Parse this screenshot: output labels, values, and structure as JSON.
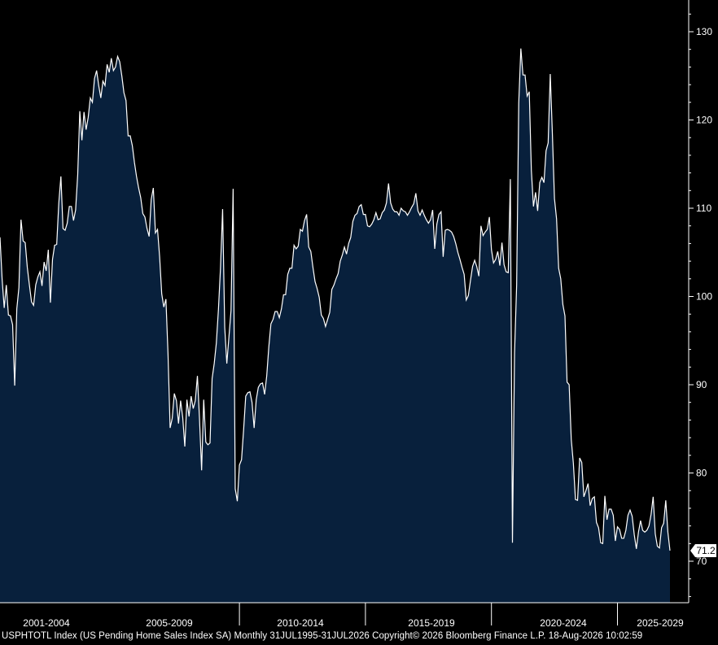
{
  "chart_data": {
    "type": "area",
    "ylim": [
      65,
      135
    ],
    "grid": false,
    "colors": {
      "background": "#000000",
      "fill": "#08203c",
      "line": "#ffffff",
      "axis": "#ffffff",
      "last_label_bg": "#ffffff",
      "last_label_text": "#000000"
    },
    "y_ticks": [
      70,
      80,
      90,
      100,
      110,
      120,
      130
    ],
    "x_period_labels": [
      "2001-2004",
      "2005-2009",
      "2010-2014",
      "2015-2019",
      "2020-2024",
      "2025-2029"
    ],
    "last_value_label": "71.2",
    "series": [
      {
        "values": [
          106.7,
          102,
          98.7,
          101.3,
          97.9,
          97.8,
          96.8,
          89.9,
          98.6,
          101,
          108.7,
          106.3,
          106.1,
          103.3,
          101.3,
          99.4,
          99,
          101.3,
          102.2,
          102.8,
          101.2,
          103.9,
          102.9,
          105.3,
          99.3,
          104.2,
          105.8,
          105.9,
          110.6,
          113.6,
          107.7,
          107.5,
          108.3,
          110.2,
          110.2,
          108.6,
          109.8,
          113.8,
          121,
          117.7,
          120.9,
          118.9,
          120.3,
          122.5,
          122,
          124.7,
          125.6,
          123.9,
          122.5,
          124.4,
          123.9,
          126.3,
          125.4,
          127,
          125.6,
          126,
          127.2,
          126.6,
          125,
          123.1,
          122.2,
          118.2,
          118.2,
          117.1,
          115.2,
          113.6,
          112.3,
          111.2,
          109.4,
          109,
          107.7,
          106.8,
          111,
          112.3,
          107.2,
          107.6,
          104.5,
          100.3,
          98.8,
          99.7,
          93.5,
          85.1,
          86.2,
          89,
          88.2,
          85.6,
          88.2,
          86.3,
          83,
          88.3,
          86.4,
          88.7,
          87.3,
          88.2,
          91,
          86.1,
          80.3,
          88.3,
          83.5,
          83.2,
          83.4,
          90.7,
          92.4,
          94.7,
          98.5,
          103.3,
          109.9,
          96.5,
          92.4,
          95.4,
          98.4,
          112.2,
          78.2,
          76.8,
          80.9,
          81.5,
          84.9,
          88.7,
          89.1,
          89.2,
          88,
          85.1,
          88.3,
          89.7,
          90.1,
          90.2,
          88.9,
          91,
          94.3,
          96.9,
          97.4,
          98.3,
          98.3,
          97.6,
          98.6,
          100.2,
          100.2,
          102.5,
          103.2,
          103.2,
          105.8,
          105.4,
          105.7,
          107.6,
          107.4,
          108.6,
          109.3,
          105.6,
          105.1,
          103.3,
          101.7,
          100.9,
          99.9,
          97.9,
          97.5,
          96.6,
          97.4,
          98.2,
          100.8,
          101.3,
          102,
          102.6,
          104,
          104.7,
          105.6,
          104.8,
          106,
          106.7,
          108.5,
          109.2,
          109.4,
          110.2,
          110.4,
          109.3,
          109.3,
          108,
          107.9,
          108.2,
          108.7,
          109.5,
          108.7,
          108.8,
          109.5,
          109.8,
          110.6,
          112.8,
          110.6,
          109.9,
          109.6,
          109.6,
          109.2,
          110,
          109.7,
          109.6,
          109.2,
          109.6,
          110.1,
          110.5,
          111.7,
          109.7,
          109.2,
          109.8,
          109.2,
          108.7,
          108.3,
          108.7,
          109.8,
          105.4,
          108.2,
          109.3,
          109.6,
          104.5,
          107.5,
          107.6,
          107.5,
          107.3,
          106.8,
          106,
          105,
          104.2,
          103.3,
          102.5,
          99.6,
          100.1,
          101.8,
          103.4,
          104.1,
          103.4,
          102.3,
          108,
          106.9,
          107.3,
          107.6,
          109,
          105.3,
          103.8,
          104.2,
          105.1,
          103.5,
          106.1,
          103.6,
          102.8,
          102.7,
          113.3,
          72.1,
          93.6,
          101.3,
          121.9,
          128.1,
          125.1,
          125.1,
          122.7,
          123.2,
          114.3,
          110.2,
          111.8,
          109.7,
          112.9,
          113.5,
          112.9,
          116.5,
          117.4,
          125.2,
          118.5,
          111.1,
          108.8,
          103.2,
          102,
          99.1,
          97.8,
          90.3,
          90,
          83.8,
          81.1,
          77,
          76.9,
          81.7,
          81.2,
          77.3,
          78,
          78.8,
          76.3,
          77.1,
          77.3,
          74.4,
          73.8,
          72.1,
          72,
          77.4,
          74.7,
          75.9,
          75.9,
          75.2,
          72.3,
          73.9,
          73.6,
          72.6,
          72.6,
          73.5,
          75.2,
          75.8,
          75.1,
          73,
          71.4,
          73.3,
          74.6,
          73.5,
          73.3,
          73.5,
          74,
          75.3,
          77.3,
          73.1,
          71.7,
          71.5,
          73.8,
          74.3,
          76.9,
          73.3,
          71.2
        ]
      }
    ]
  },
  "footer": {
    "text": "USPHTOTL Index (US Pending Home Sales Index SA) Monthly 31JUL1995-31JUL2026 Copyright© 2026 Bloomberg Finance L.P. 18-Aug-2026 10:02:59"
  }
}
